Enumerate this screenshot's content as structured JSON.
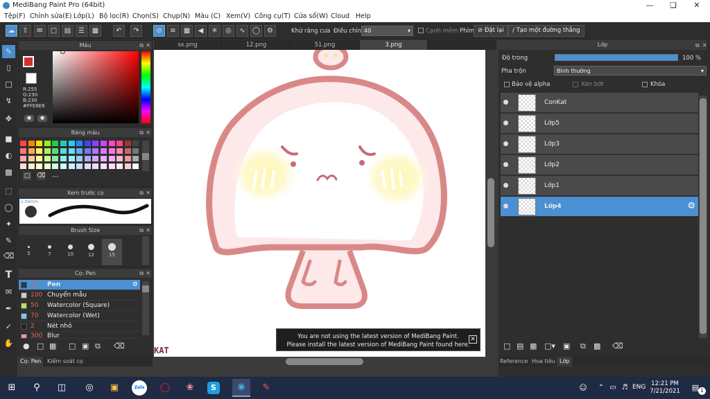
{
  "titlebar": {
    "title": "MediBang Paint Pro (64bit)"
  },
  "menu": [
    "Tệp(F)",
    "Chỉnh sửa(E)",
    "Lớp(L)",
    "Bộ lọc(R)",
    "Chọn(S)",
    "Chụp(N)",
    "Màu (C)",
    "Xem(V)",
    "Công cụ(T)",
    "Cửa sổ(W)",
    "Cloud",
    "Help"
  ],
  "toolbar": {
    "antialias_label": "Khử răng cưa",
    "adjust_label": "Điều chỉnh",
    "adjust_value": "40",
    "snap_label": "Cạnh mềm",
    "key_label": "Phím",
    "reset_label": "Đặt lại",
    "ruler_label": "Tạo một đường thẳng"
  },
  "color_panel": {
    "title": "Màu",
    "r": "R:255",
    "g": "G:230",
    "b": "B:230",
    "hex": "#FFE6E6"
  },
  "palette_panel": {
    "title": "Bảng màu",
    "extra": "---"
  },
  "preview_panel": {
    "title": "Xem trước cọ",
    "size": "1.09mm"
  },
  "brushsize_panel": {
    "title": "Brush Size",
    "sizes": [
      "5",
      "7",
      "10",
      "12",
      "15"
    ]
  },
  "brush_panel": {
    "title": "Cọ: Pen",
    "items": [
      {
        "size": "15",
        "name": "Pen",
        "color": "#1d3c5c"
      },
      {
        "size": "100",
        "name": "Chuyển mẫu",
        "color": "#cccccc"
      },
      {
        "size": "50",
        "name": "Watercolor (Square)",
        "color": "#b5e06a"
      },
      {
        "size": "70",
        "name": "Watercolor (Wet)",
        "color": "#7ec8f0"
      },
      {
        "size": "2",
        "name": "Nét nhỏ",
        "color": "#222222"
      },
      {
        "size": "300",
        "name": "Blur",
        "color": "#f090c8"
      }
    ]
  },
  "bottom_tabs_left": [
    "Cọ: Pen",
    "Kiểm soát cọ"
  ],
  "tabs": [
    "sx.png",
    "12.png",
    "51.png",
    "3.png"
  ],
  "notice": [
    "You are not using the latest version of MediBang Paint.",
    "Please install the latest version of MediBang Paint found here."
  ],
  "canvas_signature": "KAT",
  "layer_panel": {
    "title": "Lớp",
    "opacity_label": "Độ trong",
    "opacity_value": "100 %",
    "opacity_fraction": 1.0,
    "blend_label": "Pha trộn",
    "blend_value": "Bình thường",
    "protect_alpha": "Bảo vệ alpha",
    "clip": "Xén bớt",
    "lock": "Khóa",
    "layers": [
      "ConKat",
      "Lớp5",
      "Lớp3",
      "Lớp2",
      "Lớp1",
      "Lớp4"
    ]
  },
  "bottom_tabs_right": [
    "Reference",
    "Hoa tiêu",
    "Lớp"
  ],
  "taskbar": {
    "lang": "ENG",
    "time": "12:21 PM",
    "date": "7/21/2021",
    "notif": "1",
    "zalo": "Zalo"
  }
}
